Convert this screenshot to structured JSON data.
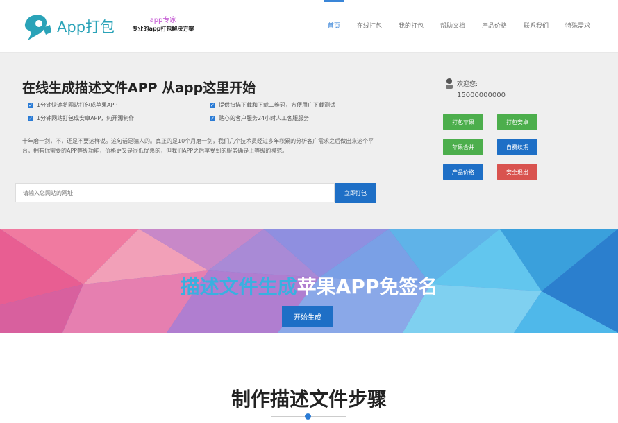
{
  "header": {
    "logo_text": "App打包",
    "slogan_top": "app专家",
    "slogan_bottom": "专业的app打包解决方案",
    "nav": [
      "首页",
      "在线打包",
      "我的打包",
      "帮助文档",
      "产品价格",
      "联系我们",
      "特殊需求"
    ],
    "active_color": "#2a7bd5"
  },
  "intro": {
    "title": "在线生成描述文件APP 从app这里开始",
    "features": [
      "1分钟快速将网站打包成苹果APP",
      "提供扫描下载和下载二维码，方便用户下载测试",
      "1分钟网站打包成安卓APP，纯开源制作",
      "贴心的客户服务24小时人工客服服务"
    ],
    "description": "十年磨一剑，不，还是不要这样说。这句话是骗人的。真正的是10个月磨一剑，我们几个技术员经过多年积累的分析客户需求之后做出来这个平台，拥有你需要的APP等级功能，价格更又是很低优惠的，但我们APP之后享受到的服务确是上等级的模范。",
    "url_placeholder": "请输入您网站的网址",
    "submit_label": "立即打包"
  },
  "user": {
    "welcome": "欢迎您:",
    "phone": "15000000000",
    "buttons": [
      "打包苹果",
      "打包安卓",
      "苹果合并",
      "自费续期",
      "产品价格",
      "安全退出"
    ]
  },
  "banner": {
    "title_part1": "描述文件生成",
    "title_part2": "苹果APP免签名",
    "button": "开始生成"
  },
  "steps": {
    "title": "制作描述文件步骤"
  }
}
